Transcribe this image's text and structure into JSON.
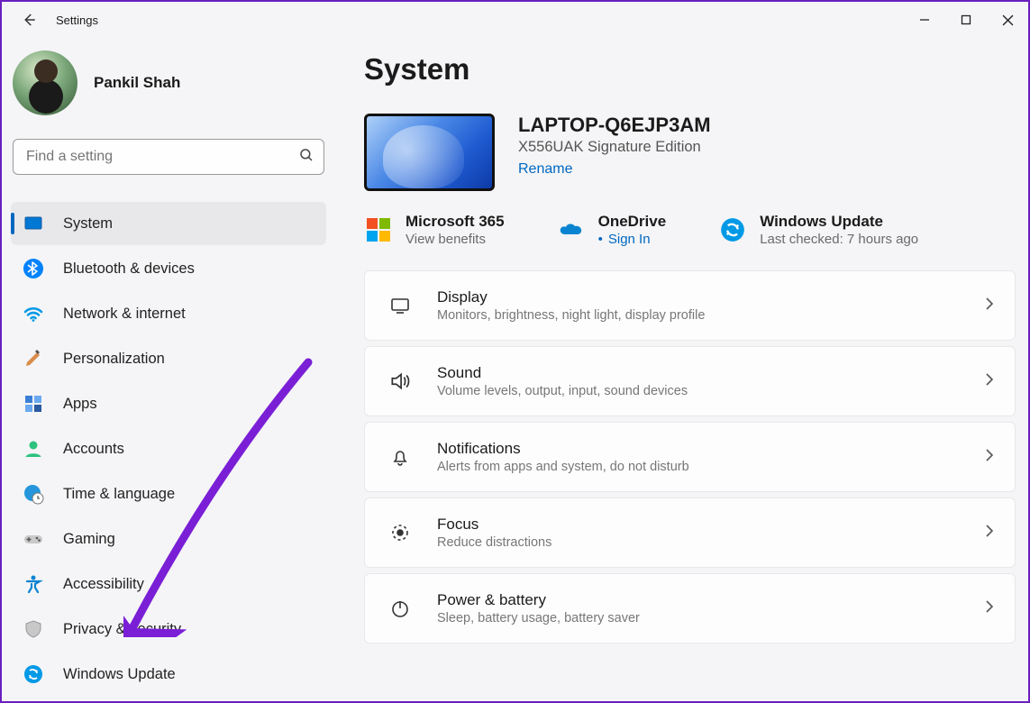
{
  "titlebar": {
    "title": "Settings"
  },
  "user": {
    "name": "Pankil Shah"
  },
  "search": {
    "placeholder": "Find a setting"
  },
  "nav": [
    {
      "id": "system",
      "label": "System",
      "active": true
    },
    {
      "id": "bluetooth",
      "label": "Bluetooth & devices"
    },
    {
      "id": "network",
      "label": "Network & internet"
    },
    {
      "id": "personalization",
      "label": "Personalization"
    },
    {
      "id": "apps",
      "label": "Apps"
    },
    {
      "id": "accounts",
      "label": "Accounts"
    },
    {
      "id": "time",
      "label": "Time & language"
    },
    {
      "id": "gaming",
      "label": "Gaming"
    },
    {
      "id": "accessibility",
      "label": "Accessibility"
    },
    {
      "id": "privacy",
      "label": "Privacy & security"
    },
    {
      "id": "update",
      "label": "Windows Update"
    }
  ],
  "page": {
    "title": "System",
    "device": {
      "name": "LAPTOP-Q6EJP3AM",
      "model": "X556UAK Signature Edition",
      "rename": "Rename"
    },
    "quick": {
      "ms365": {
        "title": "Microsoft 365",
        "sub": "View benefits"
      },
      "onedrive": {
        "title": "OneDrive",
        "sub": "Sign In"
      },
      "update": {
        "title": "Windows Update",
        "sub": "Last checked: 7 hours ago"
      }
    },
    "cards": [
      {
        "id": "display",
        "title": "Display",
        "sub": "Monitors, brightness, night light, display profile"
      },
      {
        "id": "sound",
        "title": "Sound",
        "sub": "Volume levels, output, input, sound devices"
      },
      {
        "id": "notifications",
        "title": "Notifications",
        "sub": "Alerts from apps and system, do not disturb"
      },
      {
        "id": "focus",
        "title": "Focus",
        "sub": "Reduce distractions"
      },
      {
        "id": "power",
        "title": "Power & battery",
        "sub": "Sleep, battery usage, battery saver"
      }
    ]
  }
}
